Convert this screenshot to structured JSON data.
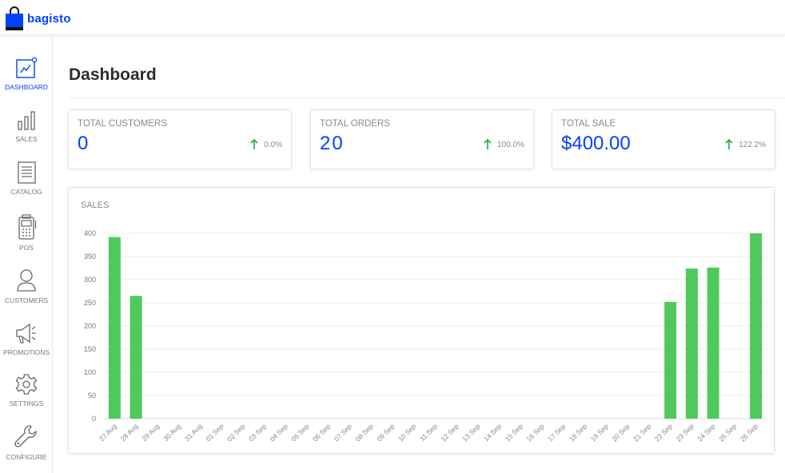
{
  "brand": {
    "name": "bagisto"
  },
  "sidebar": {
    "items": [
      {
        "label": "DASHBOARD",
        "icon": "dashboard-icon",
        "active": true
      },
      {
        "label": "SALES",
        "icon": "bar-chart-icon",
        "active": false
      },
      {
        "label": "CATALOG",
        "icon": "catalog-icon",
        "active": false
      },
      {
        "label": "POS",
        "icon": "pos-terminal-icon",
        "active": false
      },
      {
        "label": "CUSTOMERS",
        "icon": "user-icon",
        "active": false
      },
      {
        "label": "PROMOTIONS",
        "icon": "megaphone-icon",
        "active": false
      },
      {
        "label": "SETTINGS",
        "icon": "gear-icon",
        "active": false
      },
      {
        "label": "CONFIGURE",
        "icon": "wrench-icon",
        "active": false
      }
    ]
  },
  "page": {
    "title": "Dashboard"
  },
  "stats": [
    {
      "label": "TOTAL CUSTOMERS",
      "value": "0",
      "change": "0.0%"
    },
    {
      "label": "TOTAL ORDERS",
      "value": "20",
      "change": "100.0%"
    },
    {
      "label": "TOTAL SALE",
      "value": "$400.00",
      "change": "122.2%"
    }
  ],
  "colors": {
    "accent": "#0041ff",
    "bar": "#4fc95b",
    "up_arrow": "#28a745"
  },
  "chart_data": {
    "type": "bar",
    "title": "SALES",
    "categories": [
      "27 Aug",
      "28 Aug",
      "29 Aug",
      "30 Aug",
      "31 Aug",
      "01 Sep",
      "02 Sep",
      "03 Sep",
      "04 Sep",
      "05 Sep",
      "06 Sep",
      "07 Sep",
      "08 Sep",
      "09 Sep",
      "10 Sep",
      "11 Sep",
      "12 Sep",
      "13 Sep",
      "14 Sep",
      "15 Sep",
      "16 Sep",
      "17 Sep",
      "18 Sep",
      "19 Sep",
      "20 Sep",
      "21 Sep",
      "22 Sep",
      "23 Sep",
      "24 Sep",
      "25 Sep",
      "26 Sep"
    ],
    "values": [
      392,
      265,
      0,
      0,
      0,
      0,
      0,
      0,
      0,
      0,
      0,
      0,
      0,
      0,
      0,
      0,
      0,
      0,
      0,
      0,
      0,
      0,
      0,
      0,
      0,
      0,
      252,
      324,
      326,
      0,
      400
    ],
    "yticks": [
      0,
      50,
      100,
      150,
      200,
      250,
      300,
      350,
      400
    ],
    "ylim": [
      0,
      400
    ],
    "grid": true,
    "legend": "none"
  }
}
